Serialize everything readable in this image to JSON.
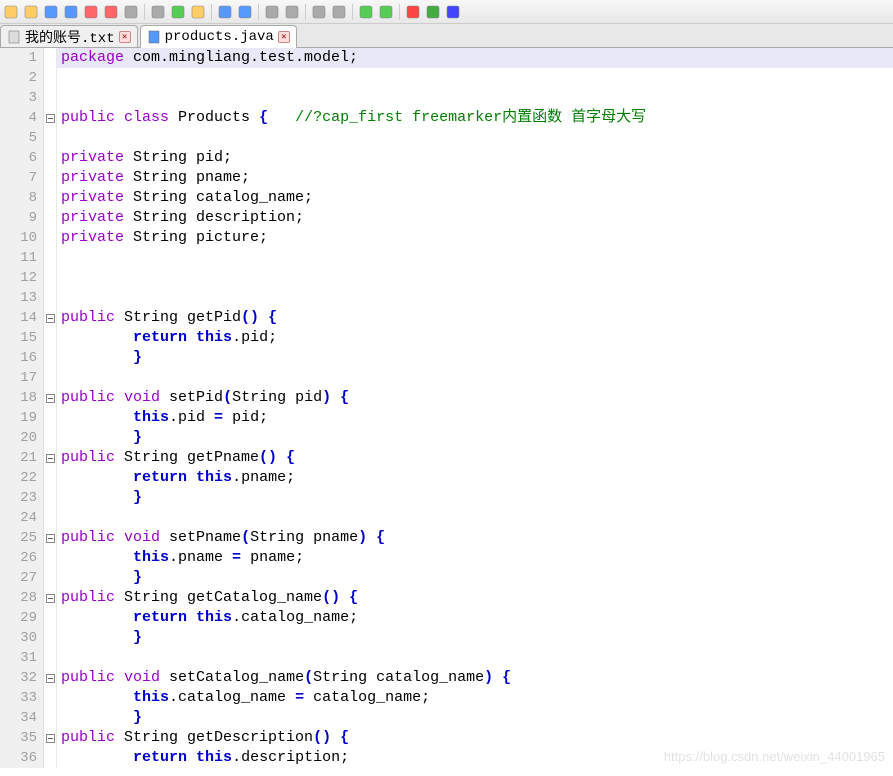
{
  "toolbar_icons": [
    "new",
    "open",
    "save",
    "save-all",
    "close",
    "close-all",
    "print",
    "sep",
    "cut",
    "copy",
    "paste",
    "sep",
    "undo",
    "redo",
    "sep",
    "find",
    "replace",
    "sep",
    "zoom-in",
    "zoom-out",
    "sep",
    "wrap",
    "show-ws",
    "sep",
    "macro-rec",
    "macro-play",
    "macro-stop"
  ],
  "tabs": [
    {
      "label": "我的账号.txt",
      "icon": "text-file-icon",
      "active": false,
      "has_close": true
    },
    {
      "label": "products.java",
      "icon": "java-file-icon",
      "active": true,
      "has_close": true
    }
  ],
  "code": {
    "highlight_line": 1,
    "lines": [
      {
        "n": 1,
        "fold": false,
        "tokens": [
          [
            "mod",
            "package"
          ],
          [
            "plain",
            " com.mingliang.test.model;"
          ]
        ]
      },
      {
        "n": 2,
        "fold": false,
        "tokens": []
      },
      {
        "n": 3,
        "fold": false,
        "tokens": []
      },
      {
        "n": 4,
        "fold": true,
        "tokens": [
          [
            "mod",
            "public"
          ],
          [
            "plain",
            " "
          ],
          [
            "mod",
            "class"
          ],
          [
            "plain",
            " Products "
          ],
          [
            "brace",
            "{"
          ],
          [
            "plain",
            "   "
          ],
          [
            "comment",
            "//?cap_first freemarker内置函数 首字母大写"
          ]
        ]
      },
      {
        "n": 5,
        "fold": false,
        "tokens": []
      },
      {
        "n": 6,
        "fold": false,
        "tokens": [
          [
            "mod",
            "private"
          ],
          [
            "plain",
            " String pid;"
          ]
        ]
      },
      {
        "n": 7,
        "fold": false,
        "tokens": [
          [
            "mod",
            "private"
          ],
          [
            "plain",
            " String pname;"
          ]
        ]
      },
      {
        "n": 8,
        "fold": false,
        "tokens": [
          [
            "mod",
            "private"
          ],
          [
            "plain",
            " String catalog_name;"
          ]
        ]
      },
      {
        "n": 9,
        "fold": false,
        "tokens": [
          [
            "mod",
            "private"
          ],
          [
            "plain",
            " String description;"
          ]
        ]
      },
      {
        "n": 10,
        "fold": false,
        "tokens": [
          [
            "mod",
            "private"
          ],
          [
            "plain",
            " String picture;"
          ]
        ]
      },
      {
        "n": 11,
        "fold": false,
        "tokens": []
      },
      {
        "n": 12,
        "fold": false,
        "tokens": []
      },
      {
        "n": 13,
        "fold": false,
        "tokens": []
      },
      {
        "n": 14,
        "fold": true,
        "tokens": [
          [
            "mod",
            "public"
          ],
          [
            "plain",
            " String getPid"
          ],
          [
            "brace",
            "()"
          ],
          [
            "plain",
            " "
          ],
          [
            "brace",
            "{"
          ]
        ]
      },
      {
        "n": 15,
        "fold": false,
        "tokens": [
          [
            "plain",
            "        "
          ],
          [
            "kw",
            "return"
          ],
          [
            "plain",
            " "
          ],
          [
            "kw",
            "this"
          ],
          [
            "plain",
            ".pid;"
          ]
        ]
      },
      {
        "n": 16,
        "fold": false,
        "tokens": [
          [
            "plain",
            "        "
          ],
          [
            "brace",
            "}"
          ]
        ]
      },
      {
        "n": 17,
        "fold": false,
        "tokens": []
      },
      {
        "n": 18,
        "fold": true,
        "tokens": [
          [
            "mod",
            "public"
          ],
          [
            "plain",
            " "
          ],
          [
            "mod",
            "void"
          ],
          [
            "plain",
            " setPid"
          ],
          [
            "brace",
            "("
          ],
          [
            "plain",
            "String pid"
          ],
          [
            "brace",
            ")"
          ],
          [
            "plain",
            " "
          ],
          [
            "brace",
            "{"
          ]
        ]
      },
      {
        "n": 19,
        "fold": false,
        "tokens": [
          [
            "plain",
            "        "
          ],
          [
            "kw",
            "this"
          ],
          [
            "plain",
            ".pid "
          ],
          [
            "kw",
            "="
          ],
          [
            "plain",
            " pid;"
          ]
        ]
      },
      {
        "n": 20,
        "fold": false,
        "tokens": [
          [
            "plain",
            "        "
          ],
          [
            "brace",
            "}"
          ]
        ]
      },
      {
        "n": 21,
        "fold": true,
        "tokens": [
          [
            "mod",
            "public"
          ],
          [
            "plain",
            " String getPname"
          ],
          [
            "brace",
            "()"
          ],
          [
            "plain",
            " "
          ],
          [
            "brace",
            "{"
          ]
        ]
      },
      {
        "n": 22,
        "fold": false,
        "tokens": [
          [
            "plain",
            "        "
          ],
          [
            "kw",
            "return"
          ],
          [
            "plain",
            " "
          ],
          [
            "kw",
            "this"
          ],
          [
            "plain",
            ".pname;"
          ]
        ]
      },
      {
        "n": 23,
        "fold": false,
        "tokens": [
          [
            "plain",
            "        "
          ],
          [
            "brace",
            "}"
          ]
        ]
      },
      {
        "n": 24,
        "fold": false,
        "tokens": []
      },
      {
        "n": 25,
        "fold": true,
        "tokens": [
          [
            "mod",
            "public"
          ],
          [
            "plain",
            " "
          ],
          [
            "mod",
            "void"
          ],
          [
            "plain",
            " setPname"
          ],
          [
            "brace",
            "("
          ],
          [
            "plain",
            "String pname"
          ],
          [
            "brace",
            ")"
          ],
          [
            "plain",
            " "
          ],
          [
            "brace",
            "{"
          ]
        ]
      },
      {
        "n": 26,
        "fold": false,
        "tokens": [
          [
            "plain",
            "        "
          ],
          [
            "kw",
            "this"
          ],
          [
            "plain",
            ".pname "
          ],
          [
            "kw",
            "="
          ],
          [
            "plain",
            " pname;"
          ]
        ]
      },
      {
        "n": 27,
        "fold": false,
        "tokens": [
          [
            "plain",
            "        "
          ],
          [
            "brace",
            "}"
          ]
        ]
      },
      {
        "n": 28,
        "fold": true,
        "tokens": [
          [
            "mod",
            "public"
          ],
          [
            "plain",
            " String getCatalog_name"
          ],
          [
            "brace",
            "()"
          ],
          [
            "plain",
            " "
          ],
          [
            "brace",
            "{"
          ]
        ]
      },
      {
        "n": 29,
        "fold": false,
        "tokens": [
          [
            "plain",
            "        "
          ],
          [
            "kw",
            "return"
          ],
          [
            "plain",
            " "
          ],
          [
            "kw",
            "this"
          ],
          [
            "plain",
            ".catalog_name;"
          ]
        ]
      },
      {
        "n": 30,
        "fold": false,
        "tokens": [
          [
            "plain",
            "        "
          ],
          [
            "brace",
            "}"
          ]
        ]
      },
      {
        "n": 31,
        "fold": false,
        "tokens": []
      },
      {
        "n": 32,
        "fold": true,
        "tokens": [
          [
            "mod",
            "public"
          ],
          [
            "plain",
            " "
          ],
          [
            "mod",
            "void"
          ],
          [
            "plain",
            " setCatalog_name"
          ],
          [
            "brace",
            "("
          ],
          [
            "plain",
            "String catalog_name"
          ],
          [
            "brace",
            ")"
          ],
          [
            "plain",
            " "
          ],
          [
            "brace",
            "{"
          ]
        ]
      },
      {
        "n": 33,
        "fold": false,
        "tokens": [
          [
            "plain",
            "        "
          ],
          [
            "kw",
            "this"
          ],
          [
            "plain",
            ".catalog_name "
          ],
          [
            "kw",
            "="
          ],
          [
            "plain",
            " catalog_name;"
          ]
        ]
      },
      {
        "n": 34,
        "fold": false,
        "tokens": [
          [
            "plain",
            "        "
          ],
          [
            "brace",
            "}"
          ]
        ]
      },
      {
        "n": 35,
        "fold": true,
        "tokens": [
          [
            "mod",
            "public"
          ],
          [
            "plain",
            " String getDescription"
          ],
          [
            "brace",
            "()"
          ],
          [
            "plain",
            " "
          ],
          [
            "brace",
            "{"
          ]
        ]
      },
      {
        "n": 36,
        "fold": false,
        "tokens": [
          [
            "plain",
            "        "
          ],
          [
            "kw",
            "return"
          ],
          [
            "plain",
            " "
          ],
          [
            "kw",
            "this"
          ],
          [
            "plain",
            ".description;"
          ]
        ]
      }
    ]
  },
  "watermark": "https://blog.csdn.net/weixin_44001965"
}
